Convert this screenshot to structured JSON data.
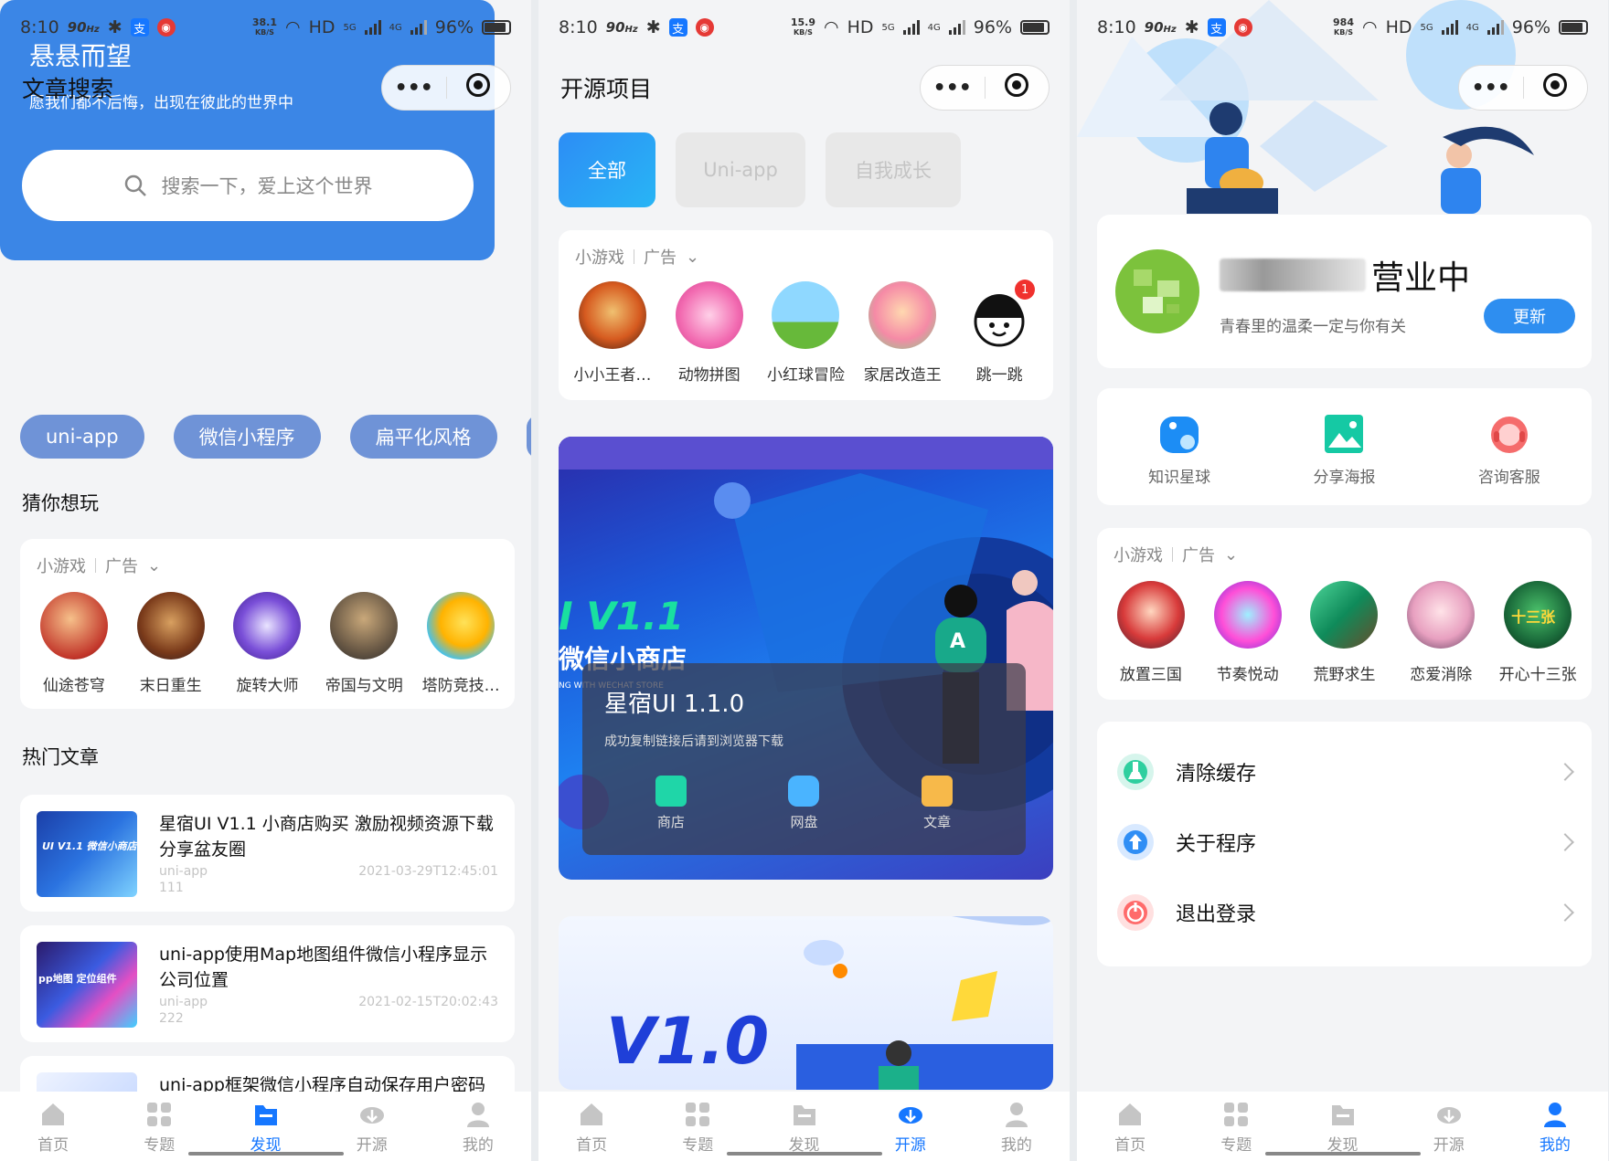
{
  "screens": [
    {
      "status": {
        "time": "8:10",
        "hz": "90",
        "hz_unit": "Hz",
        "speed": "38.1",
        "speed_unit": "KB/S",
        "hd": "HD",
        "net1": "5G",
        "net2": "4G",
        "battery": "96%"
      },
      "nav_title": "文章搜索",
      "hero": {
        "title": "悬悬而望",
        "subtitle": "愿我们都不后悔，出现在彼此的世界中",
        "search_placeholder": "搜索一下，爱上这个世界"
      },
      "tags": [
        "uni-app",
        "微信小程序",
        "扁平化风格"
      ],
      "guess_title": "猜你想玩",
      "games_label": "小游戏",
      "ad_label": "广告",
      "games": [
        "仙途苍穹",
        "末日重生",
        "旋转大师",
        "帝国与文明",
        "塔防竞技…"
      ],
      "hot_title": "热门文章",
      "articles": [
        {
          "title": "星宿UI V1.1 小商店购买 激励视频资源下载 分享盆友圈",
          "tag": "uni-app",
          "date": "2021-03-29T12:45:01",
          "views": "111",
          "thumb_text": "UI V1.1 微信小商店"
        },
        {
          "title": "uni-app使用Map地图组件微信小程序显示公司位置",
          "tag": "uni-app",
          "date": "2021-02-15T20:02:43",
          "views": "222",
          "thumb_text": "pp地图 定位组件"
        },
        {
          "title": "uni-app框架微信小程序自动保存用户密码",
          "tag": "",
          "date": "",
          "views": ""
        }
      ],
      "tabs": [
        "首页",
        "专题",
        "发现",
        "开源",
        "我的"
      ],
      "active_tab": 2
    },
    {
      "status": {
        "time": "8:10",
        "hz": "90",
        "hz_unit": "Hz",
        "speed": "15.9",
        "speed_unit": "KB/S",
        "hd": "HD",
        "net1": "5G",
        "net2": "4G",
        "battery": "96%"
      },
      "nav_title": "开源项目",
      "filters": [
        "全部",
        "Uni-app",
        "自我成长"
      ],
      "games_label": "小游戏",
      "ad_label": "广告",
      "games": [
        "小小王者…",
        "动物拼图",
        "小红球冒险",
        "家居改造王",
        "跳一跳"
      ],
      "badge": "1",
      "banner1": {
        "big_text": "I V1.1",
        "cn_text": "微信小商店",
        "small_text": "NG WITH WECHAT STORE",
        "popup_title": "星宿UI 1.1.0",
        "popup_desc": "成功复制链接后请到浏览器下载",
        "popup_items": [
          "商店",
          "网盘",
          "文章"
        ],
        "avatar_letter": "A"
      },
      "banner2": {
        "big_text": "V1.0"
      },
      "tabs": [
        "首页",
        "专题",
        "发现",
        "开源",
        "我的"
      ],
      "active_tab": 3
    },
    {
      "status": {
        "time": "8:10",
        "hz": "90",
        "hz_unit": "Hz",
        "speed": "984",
        "speed_unit": "KB/S",
        "hd": "HD",
        "net1": "5G",
        "net2": "4G",
        "battery": "96%"
      },
      "profile": {
        "status": "营业中",
        "desc": "青春里的温柔一定与你有关",
        "update": "更新"
      },
      "quick": [
        "知识星球",
        "分享海报",
        "咨询客服"
      ],
      "games_label": "小游戏",
      "ad_label": "广告",
      "games": [
        "放置三国",
        "节奏悦动",
        "荒野求生",
        "恋爱消除",
        "开心十三张"
      ],
      "game5_text": "十三张",
      "menu": [
        "清除缓存",
        "关于程序",
        "退出登录"
      ],
      "tabs": [
        "首页",
        "专题",
        "发现",
        "开源",
        "我的"
      ],
      "active_tab": 4
    }
  ],
  "colors": {
    "primary": "#1677ff",
    "hero": "#3b86e6",
    "tag": "#6f93d7",
    "update": "#2e8ef0"
  }
}
